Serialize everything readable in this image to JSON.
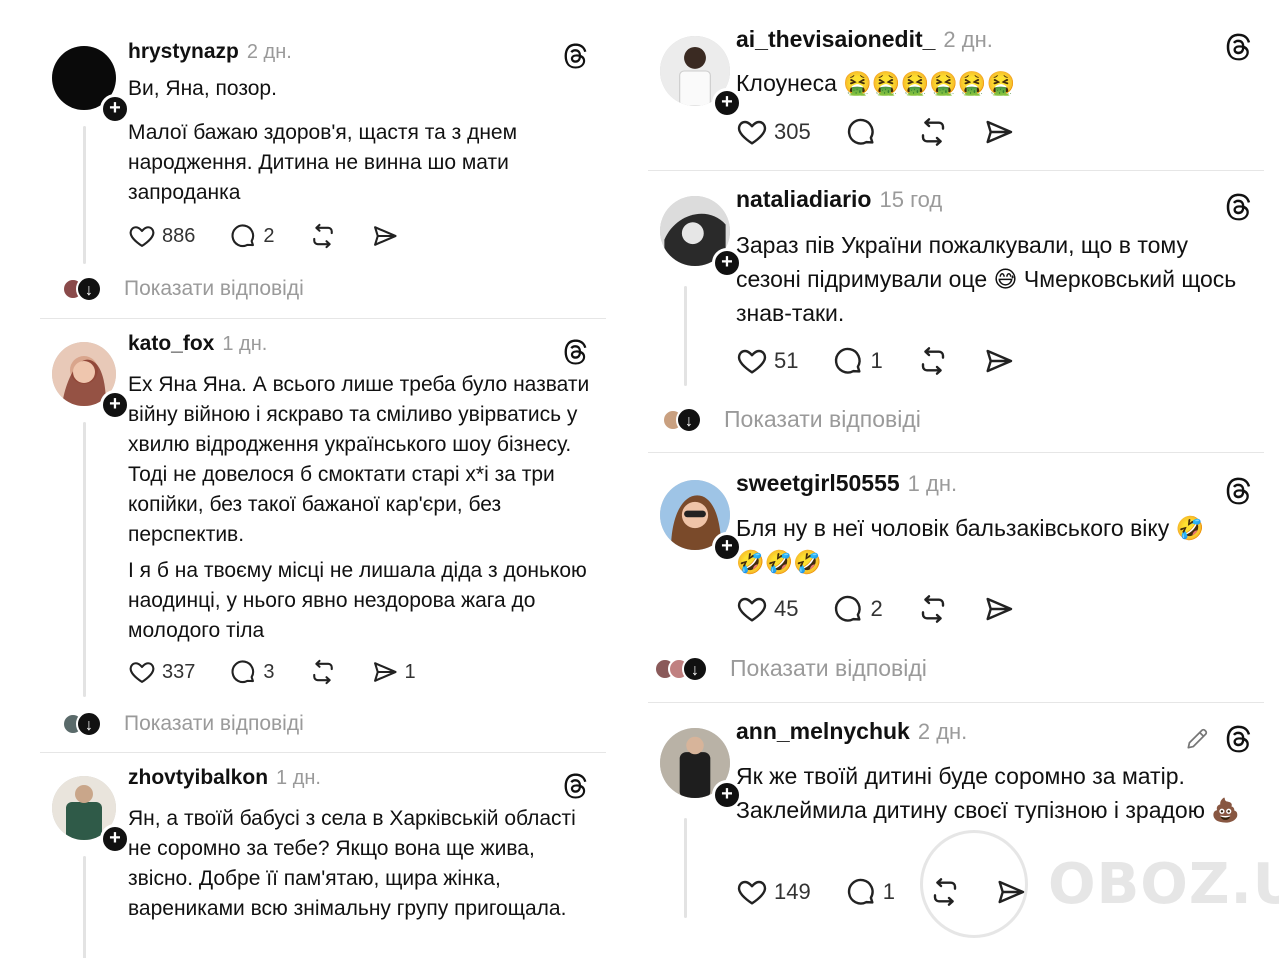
{
  "left": {
    "posts": [
      {
        "username": "hrystynazp",
        "time": "2 дн.",
        "paragraphs": [
          "Ви, Яна, позор.",
          "Малої бажаю здоров'я, щастя та з днем народження. Дитина не винна шо мати запроданка"
        ],
        "likes": "886",
        "comments": "2",
        "shares": ""
      },
      {
        "username": "kato_fox",
        "time": "1 дн.",
        "paragraphs": [
          "Ех Яна Яна. А всього лише треба було назвати війну війною і яскраво та сміливо увірватись у хвилю відродження українського шоу бізнесу. Тоді не довелося б смоктати старі х*і за три копійки, без такої бажаної кар'єри, без перспектив.",
          "І я б на твоєму місці не лишала діда з донькою наодинці, у нього явно нездорова жага до молодого тіла"
        ],
        "likes": "337",
        "comments": "3",
        "shares": "1"
      },
      {
        "username": "zhovtyibalkon",
        "time": "1 дн.",
        "paragraphs": [
          "Ян, а твоїй бабусі з села в Харківській області не соромно за тебе? Якщо вона ще жива, звісно. Добре її пам'ятаю, щира жінка, варениками всю знімальну групу пригощала."
        ]
      }
    ],
    "show_replies": "Показати відповіді"
  },
  "right": {
    "posts": [
      {
        "username": "ai_thevisaionedit_",
        "time": "2 дн.",
        "paragraphs": [
          "Клоунеса 🤮🤮🤮🤮🤮🤮"
        ],
        "likes": "305",
        "comments": "",
        "shares": ""
      },
      {
        "username": "nataliadiario",
        "time": "15 год",
        "paragraphs": [
          "Зараз пів України пожалкували, що в тому сезоні підримували оце 😅 Чмерковський щось знав-таки."
        ],
        "likes": "51",
        "comments": "1",
        "shares": ""
      },
      {
        "username": "sweetgirl50555",
        "time": "1 дн.",
        "paragraphs": [
          "Бля ну в неї чоловік бальзаківського віку 🤣 🤣🤣🤣"
        ],
        "likes": "45",
        "comments": "2",
        "shares": ""
      },
      {
        "username": "ann_melnychuk",
        "time": "2 дн.",
        "paragraphs": [
          "Як же твоїй дитині буде соромно за матір. Заклеймила дитину своєї тупізною і зрадою 💩"
        ],
        "likes": "149",
        "comments": "1",
        "shares": ""
      }
    ],
    "show_replies": "Показати відповіді"
  },
  "watermark": "OBOZ.UA",
  "icons": {
    "post_menu": "threads-logo-icon",
    "like": "heart-icon",
    "comment": "comment-bubble-icon",
    "repost": "repost-icon",
    "share": "send-icon",
    "follow": "plus-badge-icon",
    "expand_replies": "arrow-down-icon",
    "edit": "pencil-icon"
  },
  "colors": {
    "text": "#111111",
    "muted": "#9a9a9a",
    "divider": "#e6e6e6"
  }
}
